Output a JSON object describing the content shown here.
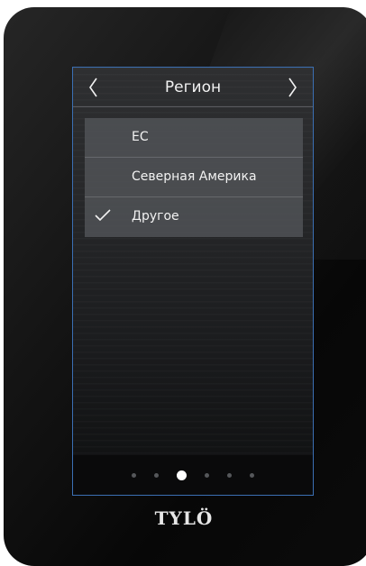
{
  "header": {
    "title": "Регион",
    "prev_icon": "chevron-left-icon",
    "next_icon": "chevron-right-icon"
  },
  "options": [
    {
      "label": "EC",
      "selected": false
    },
    {
      "label": "Северная Америка",
      "selected": false
    },
    {
      "label": "Другое",
      "selected": true
    }
  ],
  "pagination": {
    "count": 6,
    "active_index": 2
  },
  "brand": {
    "logo": "TYLÖ"
  },
  "colors": {
    "screen_border": "#3b6fb3",
    "text": "#f2f2f2",
    "active_dot": "#ffffff",
    "inactive_dot": "#55575a"
  }
}
